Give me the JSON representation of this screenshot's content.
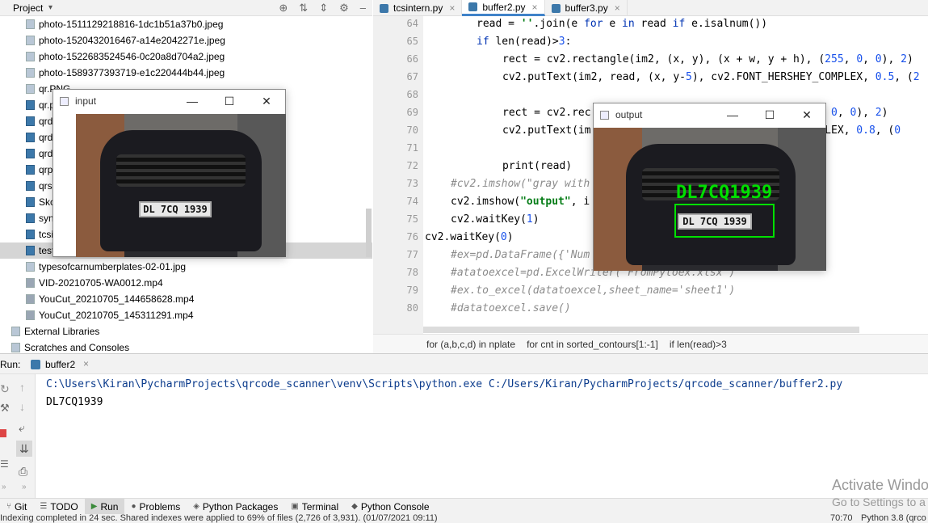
{
  "project": {
    "title": "Project",
    "files": [
      {
        "name": "photo-1511129218816-1dc1b51a37b0.jpeg",
        "type": "img"
      },
      {
        "name": "photo-1520432016467-a14e2042271e.jpeg",
        "type": "img"
      },
      {
        "name": "photo-1522683524546-0c20a8d704a2.jpeg",
        "type": "img"
      },
      {
        "name": "photo-1589377393719-e1c220444b44.jpeg",
        "type": "img"
      },
      {
        "name": "qr.PNG",
        "type": "img"
      },
      {
        "name": "qr.p",
        "type": "py"
      },
      {
        "name": "qrd",
        "type": "py"
      },
      {
        "name": "qrd",
        "type": "py"
      },
      {
        "name": "qrd",
        "type": "py"
      },
      {
        "name": "qrp",
        "type": "py"
      },
      {
        "name": "qrs",
        "type": "py"
      },
      {
        "name": "Skc",
        "type": "py"
      },
      {
        "name": "syn",
        "type": "py"
      },
      {
        "name": "tcsi",
        "type": "py"
      },
      {
        "name": "test",
        "type": "py"
      },
      {
        "name": "typesofcarnumberplates-02-01.jpg",
        "type": "img"
      },
      {
        "name": "VID-20210705-WA0012.mp4",
        "type": "mp4"
      },
      {
        "name": "YouCut_20210705_144658628.mp4",
        "type": "mp4"
      },
      {
        "name": "YouCut_20210705_145311291.mp4",
        "type": "mp4"
      }
    ],
    "external_libraries": "External Libraries",
    "scratches": "Scratches and Consoles"
  },
  "editor": {
    "tabs": [
      {
        "label": "tcsintern.py",
        "active": false
      },
      {
        "label": "buffer2.py",
        "active": true
      },
      {
        "label": "buffer3.py",
        "active": false
      }
    ],
    "lines": [
      {
        "num": "64",
        "indent": 2,
        "text": "read = ''.join(e for e in read if e.isalnum())"
      },
      {
        "num": "65",
        "indent": 2,
        "text": "if len(read)>3:"
      },
      {
        "num": "66",
        "indent": 3,
        "text": "rect = cv2.rectangle(im2, (x, y), (x + w, y + h), (255, 0, 0), 2)"
      },
      {
        "num": "67",
        "indent": 3,
        "text": "cv2.putText(im2, read, (x, y-5), cv2.FONT_HERSHEY_COMPLEX, 0.5, (2"
      },
      {
        "num": "68",
        "indent": 3,
        "text": ""
      },
      {
        "num": "69",
        "indent": 3,
        "text": "rect = cv2.rec                                 255, 0, 0), 2)"
      },
      {
        "num": "70",
        "indent": 3,
        "text": "cv2.putText(im                                 COMPLEX, 0.8, (0"
      },
      {
        "num": "71",
        "indent": 3,
        "text": ""
      },
      {
        "num": "72",
        "indent": 3,
        "text": "print(read)"
      },
      {
        "num": "73",
        "indent": 1,
        "text": "#cv2.imshow(\"gray with"
      },
      {
        "num": "74",
        "indent": 1,
        "text": "cv2.imshow(\"output\", i"
      },
      {
        "num": "75",
        "indent": 1,
        "text": "cv2.waitKey(1)"
      },
      {
        "num": "76",
        "indent": 0,
        "text": "cv2.waitKey(0)"
      },
      {
        "num": "77",
        "indent": 1,
        "text": "#ex=pd.DataFrame({'Num"
      },
      {
        "num": "78",
        "indent": 1,
        "text": "#atatoexcel=pd.ExcelWriter('FromPytoex.xlsx')"
      },
      {
        "num": "79",
        "indent": 1,
        "text": "#ex.to_excel(datatoexcel,sheet_name='sheet1')"
      },
      {
        "num": "80",
        "indent": 1,
        "text": "#datatoexcel.save()"
      }
    ],
    "breadcrumbs": [
      "for (a,b,c,d) in nplate",
      "for cnt in sorted_contours[1:-1]",
      "if len(read)>3"
    ]
  },
  "run": {
    "label": "Run:",
    "config": "buffer2",
    "command": "C:\\Users\\Kiran\\PycharmProjects\\qrcode_scanner\\venv\\Scripts\\python.exe C:/Users/Kiran/PycharmProjects/qrcode_scanner/buffer2.py",
    "output": "DL7CQ1939"
  },
  "bottom_tabs": [
    "Git",
    "TODO",
    "Run",
    "Problems",
    "Python Packages",
    "Terminal",
    "Python Console"
  ],
  "status": {
    "left": "Indexing completed in 24 sec. Shared indexes were applied to 69% of files (2,726 of 3,931). (01/07/2021 09:11)",
    "position": "70:70",
    "interpreter": "Python 3.8 (qrco"
  },
  "windows": {
    "input": {
      "title": "input",
      "plate": "DL 7CQ 1939"
    },
    "output": {
      "title": "output",
      "plate": "DL 7CQ 1939",
      "detected": "DL7CQ1939",
      "detected_color": "#00e000"
    }
  },
  "watermark": {
    "line1": "Activate Windo",
    "line2": "Go to Settings to a"
  },
  "colors": {
    "accent": "#4083c9",
    "keyword": "#0033b3",
    "string": "#067d17",
    "comment": "#8c8c8c"
  }
}
